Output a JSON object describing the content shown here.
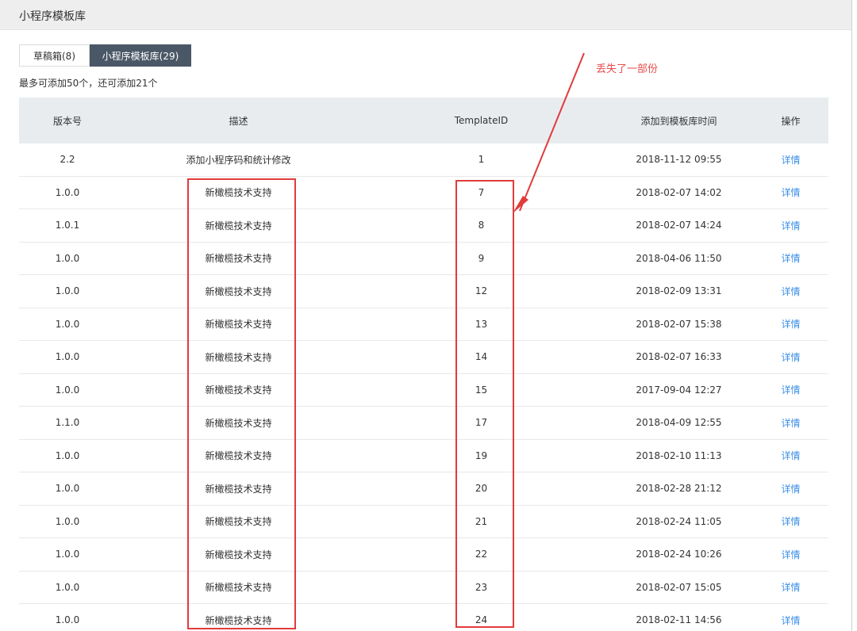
{
  "header": {
    "title": "小程序模板库"
  },
  "tabs": [
    {
      "label": "草稿箱(8)",
      "active": false
    },
    {
      "label": "小程序模板库(29)",
      "active": true
    }
  ],
  "quota_text": "最多可添加50个，还可添加21个",
  "annotation": {
    "text": "丢失了一部份",
    "color": "#e74c4c"
  },
  "table": {
    "headers": {
      "version": "版本号",
      "description": "描述",
      "template_id": "TemplateID",
      "added_time": "添加到模板库时间",
      "action": "操作"
    },
    "rows": [
      {
        "version": "2.2",
        "description": "添加小程序码和统计修改",
        "template_id": "1",
        "added_time": "2018-11-12 09:55",
        "action": "详情"
      },
      {
        "version": "1.0.0",
        "description": "新橄榄技术支持",
        "template_id": "7",
        "added_time": "2018-02-07 14:02",
        "action": "详情"
      },
      {
        "version": "1.0.1",
        "description": "新橄榄技术支持",
        "template_id": "8",
        "added_time": "2018-02-07 14:24",
        "action": "详情"
      },
      {
        "version": "1.0.0",
        "description": "新橄榄技术支持",
        "template_id": "9",
        "added_time": "2018-04-06 11:50",
        "action": "详情"
      },
      {
        "version": "1.0.0",
        "description": "新橄榄技术支持",
        "template_id": "12",
        "added_time": "2018-02-09 13:31",
        "action": "详情"
      },
      {
        "version": "1.0.0",
        "description": "新橄榄技术支持",
        "template_id": "13",
        "added_time": "2018-02-07 15:38",
        "action": "详情"
      },
      {
        "version": "1.0.0",
        "description": "新橄榄技术支持",
        "template_id": "14",
        "added_time": "2018-02-07 16:33",
        "action": "详情"
      },
      {
        "version": "1.0.0",
        "description": "新橄榄技术支持",
        "template_id": "15",
        "added_time": "2017-09-04 12:27",
        "action": "详情"
      },
      {
        "version": "1.1.0",
        "description": "新橄榄技术支持",
        "template_id": "17",
        "added_time": "2018-04-09 12:55",
        "action": "详情"
      },
      {
        "version": "1.0.0",
        "description": "新橄榄技术支持",
        "template_id": "19",
        "added_time": "2018-02-10 11:13",
        "action": "详情"
      },
      {
        "version": "1.0.0",
        "description": "新橄榄技术支持",
        "template_id": "20",
        "added_time": "2018-02-28 21:12",
        "action": "详情"
      },
      {
        "version": "1.0.0",
        "description": "新橄榄技术支持",
        "template_id": "21",
        "added_time": "2018-02-24 11:05",
        "action": "详情"
      },
      {
        "version": "1.0.0",
        "description": "新橄榄技术支持",
        "template_id": "22",
        "added_time": "2018-02-24 10:26",
        "action": "详情"
      },
      {
        "version": "1.0.0",
        "description": "新橄榄技术支持",
        "template_id": "23",
        "added_time": "2018-02-07 15:05",
        "action": "详情"
      },
      {
        "version": "1.0.0",
        "description": "新橄榄技术支持",
        "template_id": "24",
        "added_time": "2018-02-11 14:56",
        "action": "详情"
      }
    ]
  },
  "colors": {
    "accent_link": "#3a8ee6",
    "tab_active_bg": "#4a5766",
    "annotation_red": "#e23b3b",
    "header_bg": "#e9ecef"
  }
}
